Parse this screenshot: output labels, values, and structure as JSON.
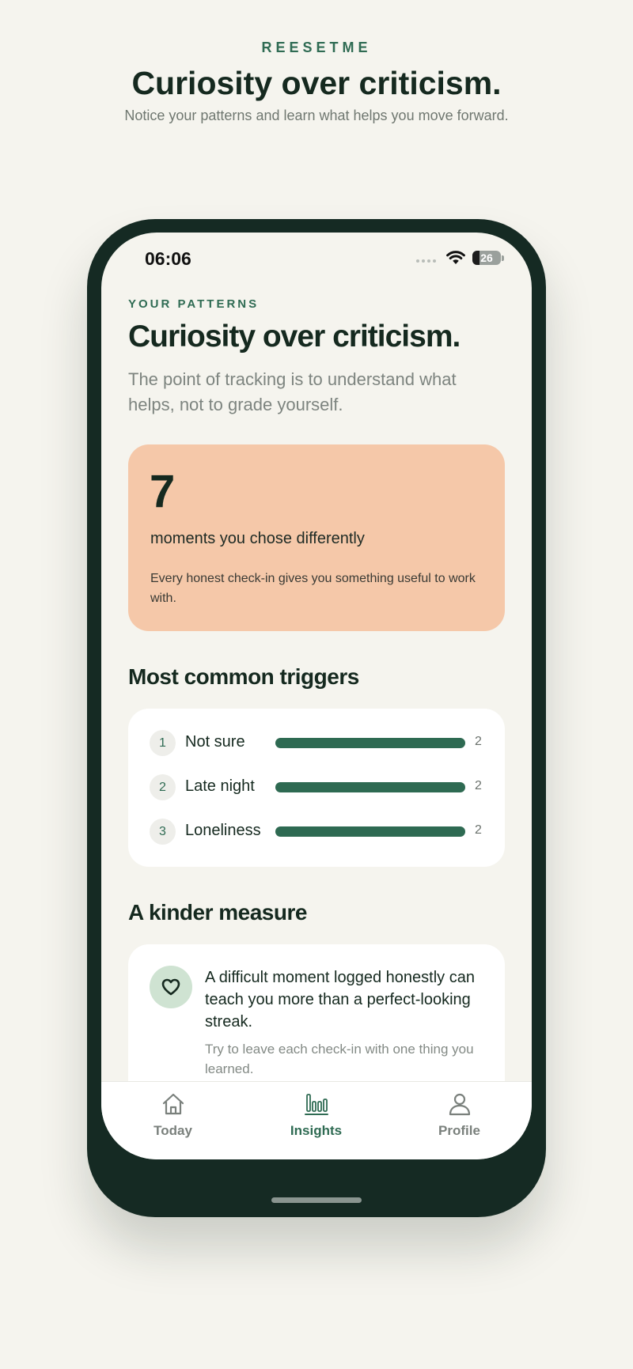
{
  "header": {
    "brand": "REESETME",
    "title": "Curiosity over criticism.",
    "subtitle": "Notice your patterns and learn what helps you move forward."
  },
  "status_bar": {
    "time": "06:06",
    "battery": "26",
    "battery_level": 0.26
  },
  "screen": {
    "eyebrow": "YOUR PATTERNS",
    "title": "Curiosity over criticism.",
    "subtitle": "The point of tracking is to understand what helps, not to grade yourself."
  },
  "stat_card": {
    "number": "7",
    "label": "moments you chose differently",
    "note": "Every honest check-in gives you something useful to work with.",
    "color": "#f5c8a9"
  },
  "triggers": {
    "title": "Most common triggers",
    "items": [
      {
        "rank": "1",
        "label": "Not sure",
        "count": "2",
        "fill": 1.0
      },
      {
        "rank": "2",
        "label": "Late night",
        "count": "2",
        "fill": 1.0
      },
      {
        "rank": "3",
        "label": "Loneliness",
        "count": "2",
        "fill": 1.0
      }
    ]
  },
  "kinder": {
    "title": "A kinder measure",
    "text": "A difficult moment logged honestly can teach you more than a perfect-looking streak.",
    "sub": "Try to leave each check-in with one thing you learned.",
    "icon": "heart-icon"
  },
  "tabs": [
    {
      "label": "Today",
      "icon": "home-icon",
      "active": false
    },
    {
      "label": "Insights",
      "icon": "bar-chart-icon",
      "active": true
    },
    {
      "label": "Profile",
      "icon": "person-icon",
      "active": false
    }
  ],
  "colors": {
    "accent": "#2f6b53",
    "dark": "#15291f",
    "background": "#f5f4ee",
    "phone_frame": "#152a23"
  }
}
